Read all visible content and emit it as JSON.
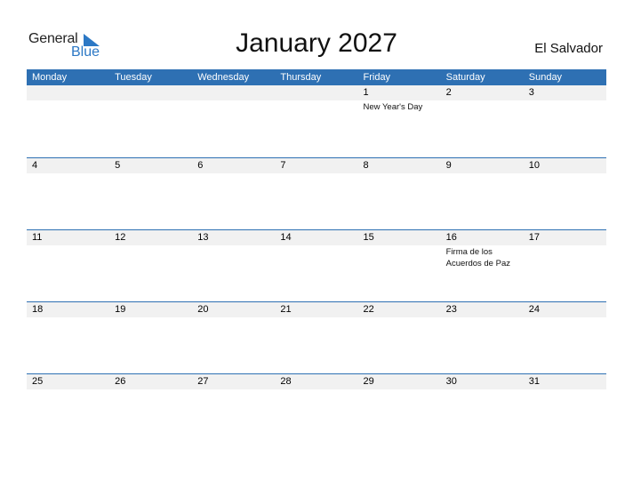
{
  "logo": {
    "general": "General",
    "blue": "Blue"
  },
  "title": "January 2027",
  "country": "El Salvador",
  "colors": {
    "accent": "#2e70b3",
    "date_strip": "#f1f1f1"
  },
  "weekdays": [
    "Monday",
    "Tuesday",
    "Wednesday",
    "Thursday",
    "Friday",
    "Saturday",
    "Sunday"
  ],
  "weeks": [
    {
      "days": [
        "",
        "",
        "",
        "",
        "1",
        "2",
        "3"
      ],
      "events": [
        "",
        "",
        "",
        "",
        "New Year's Day",
        "",
        ""
      ]
    },
    {
      "days": [
        "4",
        "5",
        "6",
        "7",
        "8",
        "9",
        "10"
      ],
      "events": [
        "",
        "",
        "",
        "",
        "",
        "",
        ""
      ]
    },
    {
      "days": [
        "11",
        "12",
        "13",
        "14",
        "15",
        "16",
        "17"
      ],
      "events": [
        "",
        "",
        "",
        "",
        "",
        "Firma de los Acuerdos de Paz",
        ""
      ]
    },
    {
      "days": [
        "18",
        "19",
        "20",
        "21",
        "22",
        "23",
        "24"
      ],
      "events": [
        "",
        "",
        "",
        "",
        "",
        "",
        ""
      ]
    },
    {
      "days": [
        "25",
        "26",
        "27",
        "28",
        "29",
        "30",
        "31"
      ],
      "events": [
        "",
        "",
        "",
        "",
        "",
        "",
        ""
      ]
    }
  ]
}
